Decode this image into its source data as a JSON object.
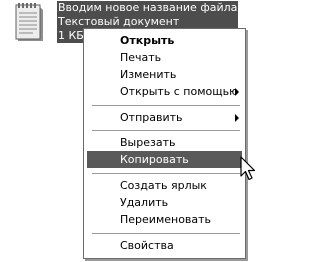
{
  "file": {
    "name": "Вводим новое название файла",
    "type": "Текстовый документ",
    "size": "1 КБ",
    "icon": "notepad-text-file-icon"
  },
  "menu": {
    "open": "Открыть",
    "print": "Печать",
    "edit": "Изменить",
    "open_with": "Открыть с помощью",
    "send_to": "Отправить",
    "cut": "Вырезать",
    "copy": "Копировать",
    "create_shortcut": "Создать ярлык",
    "delete": "Удалить",
    "rename": "Переименовать",
    "properties": "Свойства"
  },
  "highlighted_item": "copy",
  "colors": {
    "highlight": "#595959",
    "caption_bg": "#4d4d4d",
    "menu_border": "#6b6b6b"
  }
}
